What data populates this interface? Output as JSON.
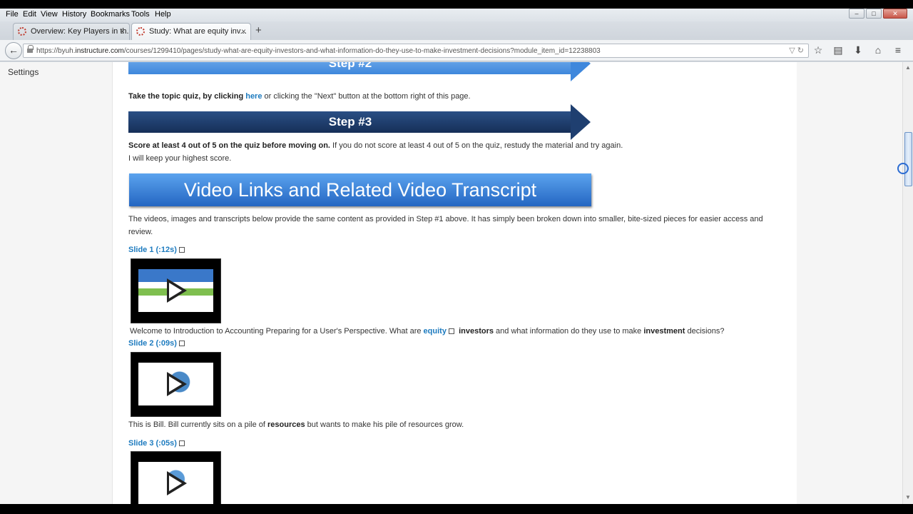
{
  "menubar": {
    "items": [
      "File",
      "Edit",
      "View",
      "History",
      "Bookmarks",
      "Tools",
      "Help"
    ]
  },
  "tabs": [
    {
      "title": "Overview: Key Players in th...",
      "close": "×"
    },
    {
      "title": "Study: What are equity inv...",
      "close": "×"
    }
  ],
  "newtab": "+",
  "navbar": {
    "back": "←",
    "url_prefix": "https://byuh.",
    "url_domain": "instructure.com",
    "url_path": "/courses/1299410/pages/study-what-are-equity-investors-and-what-information-do-they-use-to-make-investment-decisions?module_item_id=12238803",
    "url_controls": "▽  ↻",
    "icons": [
      "☆",
      "▤",
      "⬇",
      "⌂",
      "≡"
    ]
  },
  "sidebar": {
    "settings": "Settings"
  },
  "page": {
    "step2": "Step #2",
    "quiz_bold": "Take the topic quiz, by clicking ",
    "quiz_link": "here",
    "quiz_rest": " or clicking the \"Next\" button at the bottom right of this page.",
    "step3": "Step #3",
    "score_bold": "Score at least 4 out of 5 on the quiz before moving on.",
    "score_rest": " If you do not score at least 4 out of 5 on the quiz, restudy the material and try again.",
    "score_line2": "I will keep your highest score.",
    "video_header": "Video Links and Related Video Transcript",
    "intro": "The videos, images and transcripts below provide the same content as provided in Step #1 above.  It has simply been broken down into smaller, bite-sized pieces for easier access and review.",
    "slides": [
      {
        "label": "Slide 1 (:12s)"
      },
      {
        "label": "Slide 2 (:09s)"
      },
      {
        "label": "Slide 3 (:05s)"
      }
    ],
    "t1_a": "Welcome to Introduction to Accounting Preparing for a User's Perspective.  What are ",
    "t1_link": "equity",
    "t1_b": "investors",
    "t1_c": " and what information do they use to make ",
    "t1_d": "investment",
    "t1_e": " decisions?",
    "t2_a": "This is Bill.  Bill currently sits on a pile of ",
    "t2_b": "resources",
    "t2_c": " but wants to make his pile of resources grow."
  }
}
